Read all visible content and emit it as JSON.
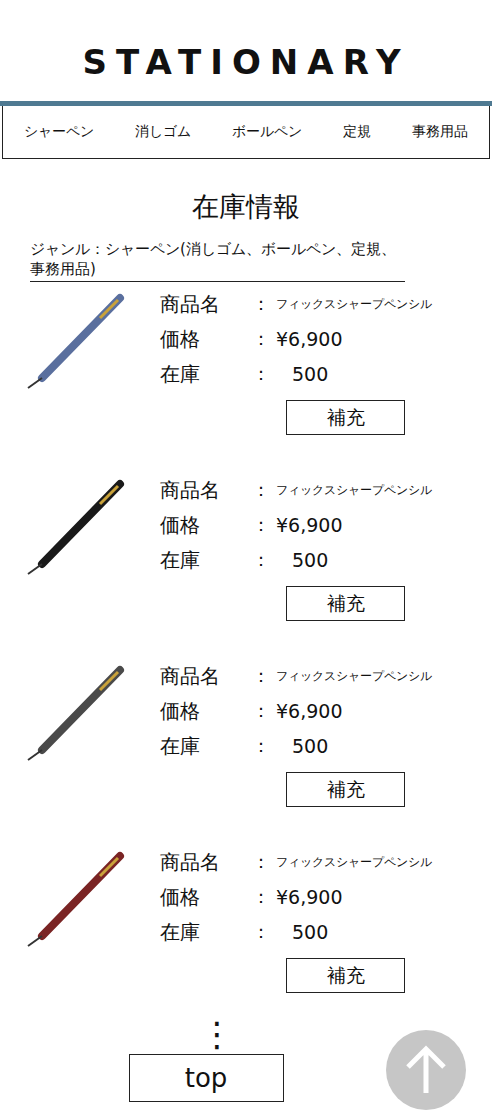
{
  "title": "STATIONARY",
  "nav": [
    {
      "label": "シャーペン"
    },
    {
      "label": "消しゴム"
    },
    {
      "label": "ボールペン"
    },
    {
      "label": "定規"
    },
    {
      "label": "事務用品"
    }
  ],
  "heading": "在庫情報",
  "genre": "ジャンル：シャーペン(消しゴム、ボールペン、定規、事務用品)",
  "labels": {
    "name": "商品名",
    "price": "価格",
    "stock": "在庫",
    "colon": "："
  },
  "products": [
    {
      "name": "フィックスシャープペンシル",
      "price": "¥6,900",
      "stock": "500",
      "restock": "補充",
      "color": "#5a6f9e"
    },
    {
      "name": "フィックスシャープペンシル",
      "price": "¥6,900",
      "stock": "500",
      "restock": "補充",
      "color": "#1a1a1a"
    },
    {
      "name": "フィックスシャープペンシル",
      "price": "¥6,900",
      "stock": "500",
      "restock": "補充",
      "color": "#4a4a4a"
    },
    {
      "name": "フィックスシャープペンシル",
      "price": "¥6,900",
      "stock": "500",
      "restock": "補充",
      "color": "#7a2424"
    }
  ],
  "more": "⋮",
  "top": "top"
}
